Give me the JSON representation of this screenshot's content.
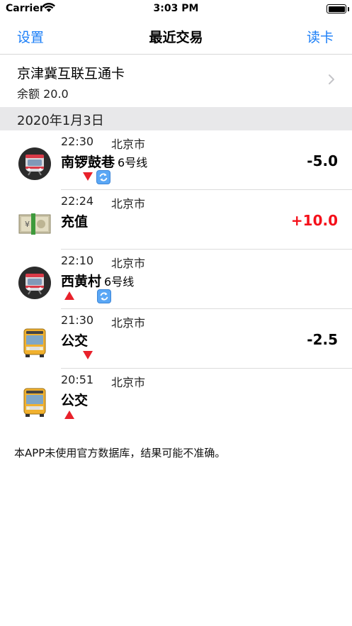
{
  "status_bar": {
    "carrier": "Carrier",
    "time": "3:03 PM"
  },
  "nav": {
    "left": "设置",
    "title": "最近交易",
    "right": "读卡"
  },
  "card": {
    "name": "京津冀互联互通卡",
    "balance": "余额 20.0"
  },
  "section": {
    "title": "2020年1月3日"
  },
  "transactions": [
    {
      "time": "22:30",
      "city": "北京市",
      "station": "南锣鼓巷",
      "line": "6号线",
      "amount": "-5.0",
      "icon": "subway-icon",
      "direction": "down",
      "transfer": true
    },
    {
      "time": "22:24",
      "city": "北京市",
      "station": "充值",
      "line": "",
      "amount": "+10.0",
      "icon": "yen-banknote-icon",
      "direction": "",
      "transfer": false
    },
    {
      "time": "22:10",
      "city": "北京市",
      "station": "西黄村",
      "line": "6号线",
      "amount": "",
      "icon": "subway-icon",
      "direction": "up",
      "transfer": true
    },
    {
      "time": "21:30",
      "city": "北京市",
      "station": "公交",
      "line": "",
      "amount": "-2.5",
      "icon": "bus-icon",
      "direction": "down",
      "transfer": false
    },
    {
      "time": "20:51",
      "city": "北京市",
      "station": "公交",
      "line": "",
      "amount": "",
      "icon": "bus-icon",
      "direction": "up",
      "transfer": false
    }
  ],
  "disclaimer": "本APP未使用官方数据库，结果可能不准确。",
  "colors": {
    "accent": "#1a7ef7",
    "positive_amount": "#f5101a",
    "section_bg": "#e8e8ea",
    "tri_red": "#e8212b"
  }
}
